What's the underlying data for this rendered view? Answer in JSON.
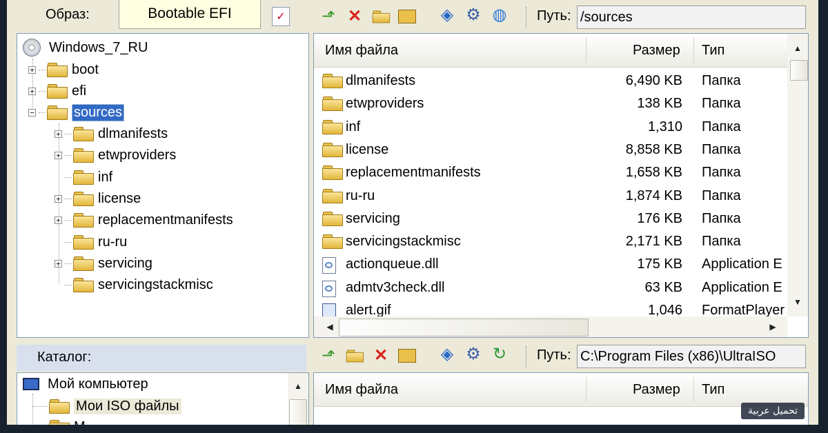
{
  "image_bar": {
    "label": "Образ:",
    "image_name": "Bootable EFI"
  },
  "top_toolbar": {
    "icons": [
      "arrow-up-icon",
      "delete-x-icon",
      "new-folder-icon",
      "rename-icon",
      "extract-icon",
      "settings-gear-icon",
      "refresh-icon"
    ],
    "path_label": "Путь:",
    "path_value": "/sources"
  },
  "tree": {
    "root": "Windows_7_RU",
    "items": [
      {
        "label": "boot"
      },
      {
        "label": "efi"
      },
      {
        "label": "sources"
      },
      {
        "label": "dlmanifests"
      },
      {
        "label": "etwproviders"
      },
      {
        "label": "inf"
      },
      {
        "label": "license"
      },
      {
        "label": "replacementmanifests"
      },
      {
        "label": "ru-ru"
      },
      {
        "label": "servicing"
      },
      {
        "label": "servicingstackmisc"
      }
    ]
  },
  "file_list": {
    "columns": {
      "name": "Имя файла",
      "size": "Размер",
      "type": "Тип"
    },
    "rows": [
      {
        "name": "dlmanifests",
        "size": "6,490 KB",
        "type": "Папка",
        "icon": "folder"
      },
      {
        "name": "etwproviders",
        "size": "138 KB",
        "type": "Папка",
        "icon": "folder"
      },
      {
        "name": "inf",
        "size": "1,310",
        "type": "Папка",
        "icon": "folder"
      },
      {
        "name": "license",
        "size": "8,858 KB",
        "type": "Папка",
        "icon": "folder"
      },
      {
        "name": "replacementmanifests",
        "size": "1,658 KB",
        "type": "Папка",
        "icon": "folder"
      },
      {
        "name": "ru-ru",
        "size": "1,874 KB",
        "type": "Папка",
        "icon": "folder"
      },
      {
        "name": "servicing",
        "size": "176 KB",
        "type": "Папка",
        "icon": "folder"
      },
      {
        "name": "servicingstackmisc",
        "size": "2,171 KB",
        "type": "Папка",
        "icon": "folder"
      },
      {
        "name": "actionqueue.dll",
        "size": "175 KB",
        "type": "Application E",
        "icon": "dll"
      },
      {
        "name": "admtv3check.dll",
        "size": "63 KB",
        "type": "Application E",
        "icon": "dll"
      },
      {
        "name": "alert.gif",
        "size": "1,046",
        "type": "FormatPlayer",
        "icon": "gif"
      }
    ]
  },
  "bottom_toolbar": {
    "catalog_label": "Каталог:",
    "path_label": "Путь:",
    "path_value": "C:\\Program Files (x86)\\UltraISO"
  },
  "local_tree": {
    "items": [
      {
        "label": "Мой компьютер"
      },
      {
        "label": "Мои ISO файлы"
      },
      {
        "label": "М"
      }
    ]
  },
  "local_list": {
    "columns": {
      "name": "Имя файла",
      "size": "Размер",
      "type": "Тип"
    }
  },
  "watermark": "تحميل عربية"
}
